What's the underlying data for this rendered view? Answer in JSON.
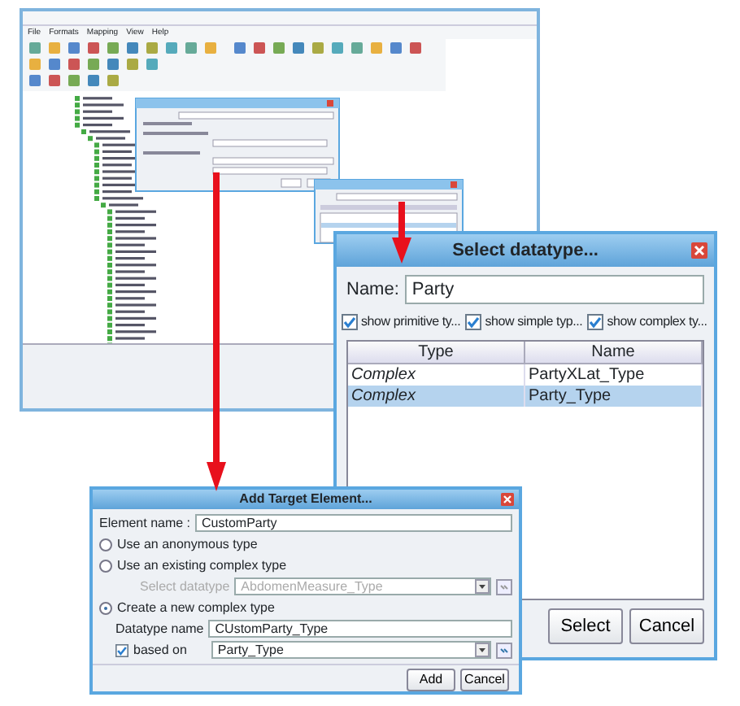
{
  "main_window": {
    "menu": [
      "File",
      "Formats",
      "Mapping",
      "View",
      "Help"
    ]
  },
  "select_dialog": {
    "title": "Select datatype...",
    "name_label": "Name:",
    "name_value": "Party",
    "filters": [
      {
        "label": "show primitive ty...",
        "checked": true
      },
      {
        "label": "show simple typ...",
        "checked": true
      },
      {
        "label": "show complex ty...",
        "checked": true
      }
    ],
    "table": {
      "columns": [
        "Type",
        "Name"
      ],
      "rows": [
        {
          "cells": [
            "Complex",
            "PartyXLat_Type"
          ],
          "selected": false
        },
        {
          "cells": [
            "Complex",
            "Party_Type"
          ],
          "selected": true
        }
      ]
    },
    "buttons": [
      "Select",
      "Cancel"
    ]
  },
  "add_dialog": {
    "title": "Add Target Element...",
    "element_name_label": "Element name :",
    "element_name": "CustomParty",
    "options": [
      {
        "label": "Use an anonymous type",
        "selected": false
      },
      {
        "label": "Use an existing complex type",
        "selected": false
      },
      {
        "label": "Create a new complex type",
        "selected": true
      }
    ],
    "select_datatype": {
      "label": "Select datatype",
      "value": "AbdomenMeasure_Type",
      "disabled": true
    },
    "datatype_name": {
      "label": "Datatype name",
      "value": "CUstomParty_Type"
    },
    "based_on": {
      "label": "based on",
      "checked": true,
      "value": "Party_Type"
    },
    "buttons": [
      "Add",
      "Cancel"
    ]
  }
}
